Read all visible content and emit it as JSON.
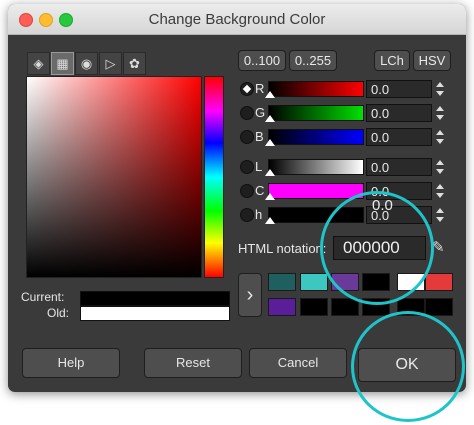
{
  "titlebar": {
    "title": "Change Background Color"
  },
  "toolbar": {
    "tools": [
      {
        "icon": "gimp-icon"
      },
      {
        "icon": "scale-icon"
      },
      {
        "icon": "watercolor-icon"
      },
      {
        "icon": "wheel-icon"
      },
      {
        "icon": "palette-icon"
      }
    ]
  },
  "range_buttons": {
    "r100": "0..100",
    "r255": "0..255"
  },
  "mode_buttons": {
    "lch": "LCh",
    "hsv": "HSV"
  },
  "channels": [
    {
      "label": "R",
      "value": "0.0",
      "gradient": [
        "#000000",
        "#ff0000"
      ],
      "selected": true
    },
    {
      "label": "G",
      "value": "0.0",
      "gradient": [
        "#000000",
        "#00e000"
      ],
      "selected": false
    },
    {
      "label": "B",
      "value": "0.0",
      "gradient": [
        "#000000",
        "#0000ff"
      ],
      "selected": false
    },
    {
      "label": "L",
      "value": "0.0",
      "gradient": [
        "#000000",
        "#ffffff"
      ],
      "selected": false
    },
    {
      "label": "C",
      "value": "0.0",
      "gradient": [
        "#ff00ff",
        "#ff00ff"
      ],
      "selected": false
    },
    {
      "label": "h",
      "value": "0.0",
      "gradient": [
        "#000000",
        "#000000"
      ],
      "selected": false
    }
  ],
  "html_notation": {
    "label": "HTML notation:",
    "value": "000000"
  },
  "current_label": "Current:",
  "old_label": "Old:",
  "current_color": "#000000",
  "old_color": "#ffffff",
  "history_colors": [
    [
      "#1f5f5f",
      "#3cc8c0",
      "#6a3a9a",
      "#000000",
      "#ffffff",
      "#e53a3a"
    ],
    [
      "#5a1e9a",
      "#000000",
      "#000000",
      "#000000",
      "#000000",
      "#000000"
    ]
  ],
  "expand_label": "›",
  "buttons": {
    "help": "Help",
    "reset": "Reset",
    "cancel": "Cancel",
    "ok": "OK"
  },
  "zoom_overlay": {
    "value": "0.0"
  },
  "accent_color": "#1ec4c9"
}
